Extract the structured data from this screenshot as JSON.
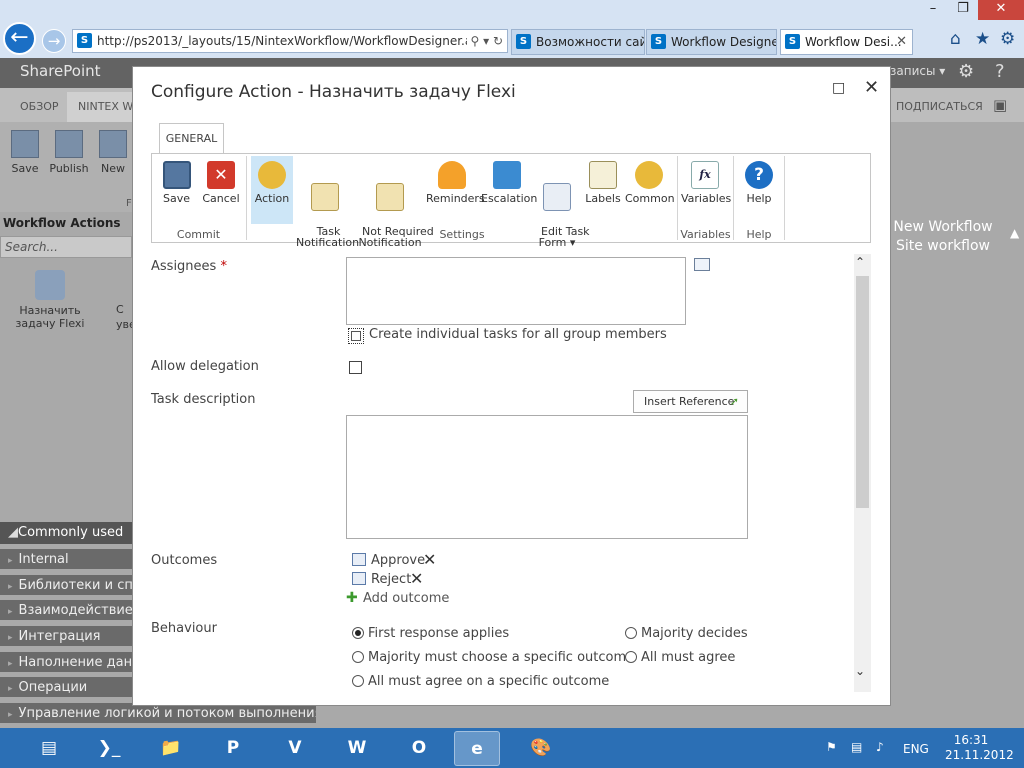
{
  "browser": {
    "url": "http://ps2013/_layouts/15/NintexWorkflow/WorkflowDesigner.aspx",
    "tabs": [
      {
        "label": "Возможности сай..."
      },
      {
        "label": "Workflow Designer"
      },
      {
        "label": "Workflow Desi..."
      }
    ],
    "sp_icon_text": "S"
  },
  "sharepoint": {
    "brand": "SharePoint",
    "top_right": "записы ▾",
    "ribbon_tabs": [
      "ОБЗОР",
      "NINTEX WO"
    ],
    "right_action": "ПОДПИСАТЬСЯ",
    "ribbon_buttons": [
      "Save",
      "Publish",
      "New"
    ],
    "ribbon_group_letter": "F",
    "workflow_actions_title": "Workflow Actions",
    "search_placeholder": "Search...",
    "action_item_label": "Назначить задачу Flexi",
    "action_item2_label": "C\nуве",
    "categories_header": "Commonly used",
    "categories": [
      "Internal",
      "Библиотеки и спис",
      "Взаимодействие с",
      "Интеграция",
      "Наполнение данн",
      "Операции",
      "Управление логикой и потоком выполнения"
    ],
    "canvas_text_line1": "New Workflow",
    "canvas_text_line2": "Site workflow"
  },
  "dialog": {
    "title": "Configure Action - Назначить задачу Flexi",
    "tab": "GENERAL",
    "ribbon": {
      "buttons": [
        {
          "label": "Save"
        },
        {
          "label": "Cancel"
        },
        {
          "label": "Action"
        },
        {
          "label": "Task\nNotification"
        },
        {
          "label": "Not Required\nNotification"
        },
        {
          "label": "Reminders"
        },
        {
          "label": "Escalation"
        },
        {
          "label": "Edit Task\nForm ▾"
        },
        {
          "label": "Labels"
        },
        {
          "label": "Common"
        },
        {
          "label": "Variables"
        },
        {
          "label": "Help"
        }
      ],
      "groups": [
        "Commit",
        "Settings",
        "Variables",
        "Help"
      ]
    },
    "form": {
      "assignees_label": "Assignees",
      "required_mark": "*",
      "individual_tasks_label": "Create individual tasks for all group members",
      "individual_tasks_checked": false,
      "allow_delegation_label": "Allow delegation",
      "allow_delegation_checked": false,
      "task_description_label": "Task description",
      "insert_reference_label": "Insert Reference",
      "outcomes_label": "Outcomes",
      "outcomes": [
        "Approve",
        "Reject"
      ],
      "add_outcome_label": "Add outcome",
      "behaviour_label": "Behaviour",
      "behaviour_options": [
        {
          "label": "First response applies",
          "selected": true
        },
        {
          "label": "Majority decides",
          "selected": false
        },
        {
          "label": "Majority must choose a specific outcome",
          "selected": false
        },
        {
          "label": "All must agree",
          "selected": false
        },
        {
          "label": "All must agree on a specific outcome",
          "selected": false
        }
      ]
    }
  },
  "taskbar": {
    "language": "ENG",
    "time": "16:31",
    "date": "21.11.2012"
  },
  "colors": {
    "sp_suite_bar": "#636363",
    "taskbar": "#2b6fb5",
    "selected_button": "#cde6f7"
  }
}
